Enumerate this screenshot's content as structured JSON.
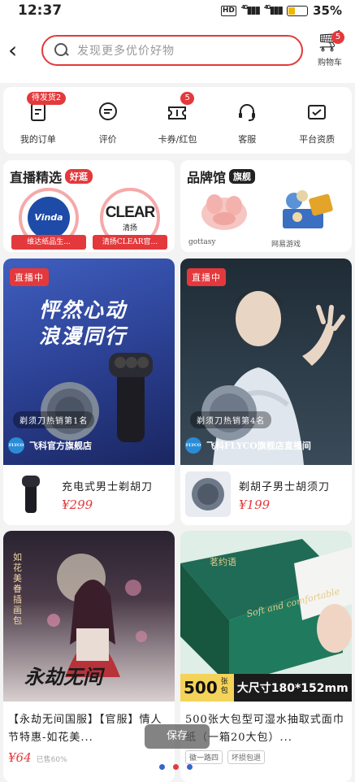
{
  "status_bar": {
    "time": "12:37",
    "hd": "HD",
    "net1": "4G",
    "net2": "4G",
    "battery": "35%",
    "battery_level": 0.35,
    "battery_color": "#f2b705"
  },
  "search": {
    "placeholder": "发现更多优价好物",
    "back_icon": "chevron-left-icon",
    "search_icon": "search-icon"
  },
  "cart": {
    "badge": "5",
    "label": "购物车",
    "icon": "cart-icon"
  },
  "services": [
    {
      "label": "我的订单",
      "icon": "order-doc-icon",
      "badge": "待发货2"
    },
    {
      "label": "评价",
      "icon": "comment-bubble-icon",
      "badge": ""
    },
    {
      "label": "卡券/红包",
      "icon": "coupon-ticket-icon",
      "badge": "5"
    },
    {
      "label": "客服",
      "icon": "headset-icon",
      "badge": ""
    },
    {
      "label": "平台资质",
      "icon": "certificate-icon",
      "badge": ""
    }
  ],
  "live_picks": {
    "title": "直播精选",
    "tag": "好逛",
    "items": [
      {
        "logo_text": "Vinda",
        "caption": "维达纸品生..."
      },
      {
        "logo_text": "CLEAR",
        "logo_sub": "清扬",
        "caption": "清扬CLEAR官..."
      }
    ]
  },
  "brand_hall": {
    "title": "品牌馆",
    "tag": "旗舰",
    "items": [
      {
        "caption": "gottasy"
      },
      {
        "caption": "网易游戏"
      }
    ]
  },
  "feed": [
    {
      "live_tag": "直播中",
      "headline1": "怦然心动",
      "headline2": "浪漫同行",
      "rank": "剃须刀热销第1名",
      "shop": "飞科官方旗舰店",
      "product": "充电式男士剃胡刀",
      "price": "¥299"
    },
    {
      "live_tag": "直播中",
      "rank": "剃须刀热销第4名",
      "shop": "飞科FLYCO旗舰店直播间",
      "product": "剃胡子男士胡须刀",
      "price": "¥199"
    },
    {
      "poster_title": "永劫无间",
      "poster_side": "如花美眷插画包",
      "title": "【永劫无间国服】【官服】情人节特惠-如花美...",
      "price": "¥64",
      "sold": "已售60%"
    },
    {
      "package_text": "Soft and comfortable",
      "brand_text": "茗约语",
      "banner_left": "500",
      "banner_unit": "张包",
      "banner_right": "大尺寸180*152mm",
      "title": "500张大包型可湿水抽取式面巾纸（一箱20大包）...",
      "chips": [
        "徽一路四",
        "坏损包退"
      ]
    }
  ],
  "toast": "保存",
  "dots": [
    "#3a64c9",
    "#e4393c",
    "#3a64c9"
  ]
}
